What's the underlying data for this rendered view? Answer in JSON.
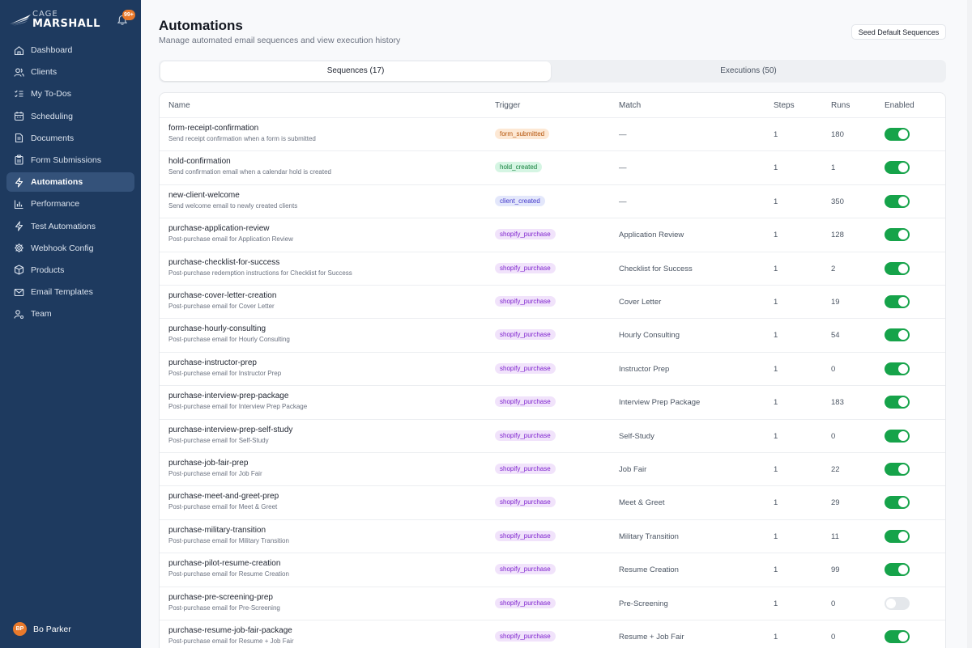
{
  "brand": {
    "top": "CAGE",
    "main": "MARSHALL"
  },
  "notifications": {
    "badge": "99+"
  },
  "sidebar": {
    "items": [
      {
        "label": "Dashboard",
        "icon": "home-icon"
      },
      {
        "label": "Clients",
        "icon": "users-icon"
      },
      {
        "label": "My To-Dos",
        "icon": "list-checks-icon"
      },
      {
        "label": "Scheduling",
        "icon": "calendar-icon"
      },
      {
        "label": "Documents",
        "icon": "file-icon"
      },
      {
        "label": "Form Submissions",
        "icon": "clipboard-icon"
      },
      {
        "label": "Automations",
        "icon": "bolt-icon",
        "active": true
      },
      {
        "label": "Performance",
        "icon": "bar-chart-icon"
      },
      {
        "label": "Test Automations",
        "icon": "bolt-icon"
      },
      {
        "label": "Webhook Config",
        "icon": "gear-icon"
      },
      {
        "label": "Products",
        "icon": "package-icon"
      },
      {
        "label": "Email Templates",
        "icon": "mail-icon"
      },
      {
        "label": "Team",
        "icon": "user-gear-icon"
      }
    ]
  },
  "user": {
    "initials": "BP",
    "name": "Bo Parker"
  },
  "header": {
    "title": "Automations",
    "subtitle": "Manage automated email sequences and view execution history",
    "seed_label": "Seed Default Sequences"
  },
  "tabs": [
    {
      "label": "Sequences (17)",
      "active": true
    },
    {
      "label": "Executions (50)",
      "active": false
    }
  ],
  "table": {
    "columns": [
      "Name",
      "Trigger",
      "Match",
      "Steps",
      "Runs",
      "Enabled"
    ],
    "rows": [
      {
        "name": "form-receipt-confirmation",
        "desc": "Send receipt confirmation when a form is submitted",
        "trigger": "form_submitted",
        "match": "—",
        "steps": "1",
        "runs": "180",
        "enabled": true
      },
      {
        "name": "hold-confirmation",
        "desc": "Send confirmation email when a calendar hold is created",
        "trigger": "hold_created",
        "match": "—",
        "steps": "1",
        "runs": "1",
        "enabled": true
      },
      {
        "name": "new-client-welcome",
        "desc": "Send welcome email to newly created clients",
        "trigger": "client_created",
        "match": "—",
        "steps": "1",
        "runs": "350",
        "enabled": true
      },
      {
        "name": "purchase-application-review",
        "desc": "Post-purchase email for Application Review",
        "trigger": "shopify_purchase",
        "match": "Application Review",
        "steps": "1",
        "runs": "128",
        "enabled": true
      },
      {
        "name": "purchase-checklist-for-success",
        "desc": "Post-purchase redemption instructions for Checklist for Success",
        "trigger": "shopify_purchase",
        "match": "Checklist for Success",
        "steps": "1",
        "runs": "2",
        "enabled": true
      },
      {
        "name": "purchase-cover-letter-creation",
        "desc": "Post-purchase email for Cover Letter",
        "trigger": "shopify_purchase",
        "match": "Cover Letter",
        "steps": "1",
        "runs": "19",
        "enabled": true
      },
      {
        "name": "purchase-hourly-consulting",
        "desc": "Post-purchase email for Hourly Consulting",
        "trigger": "shopify_purchase",
        "match": "Hourly Consulting",
        "steps": "1",
        "runs": "54",
        "enabled": true
      },
      {
        "name": "purchase-instructor-prep",
        "desc": "Post-purchase email for Instructor Prep",
        "trigger": "shopify_purchase",
        "match": "Instructor Prep",
        "steps": "1",
        "runs": "0",
        "enabled": true
      },
      {
        "name": "purchase-interview-prep-package",
        "desc": "Post-purchase email for Interview Prep Package",
        "trigger": "shopify_purchase",
        "match": "Interview Prep Package",
        "steps": "1",
        "runs": "183",
        "enabled": true
      },
      {
        "name": "purchase-interview-prep-self-study",
        "desc": "Post-purchase email for Self-Study",
        "trigger": "shopify_purchase",
        "match": "Self-Study",
        "steps": "1",
        "runs": "0",
        "enabled": true
      },
      {
        "name": "purchase-job-fair-prep",
        "desc": "Post-purchase email for Job Fair",
        "trigger": "shopify_purchase",
        "match": "Job Fair",
        "steps": "1",
        "runs": "22",
        "enabled": true
      },
      {
        "name": "purchase-meet-and-greet-prep",
        "desc": "Post-purchase email for Meet & Greet",
        "trigger": "shopify_purchase",
        "match": "Meet & Greet",
        "steps": "1",
        "runs": "29",
        "enabled": true
      },
      {
        "name": "purchase-military-transition",
        "desc": "Post-purchase email for Military Transition",
        "trigger": "shopify_purchase",
        "match": "Military Transition",
        "steps": "1",
        "runs": "11",
        "enabled": true
      },
      {
        "name": "purchase-pilot-resume-creation",
        "desc": "Post-purchase email for Resume Creation",
        "trigger": "shopify_purchase",
        "match": "Resume Creation",
        "steps": "1",
        "runs": "99",
        "enabled": true
      },
      {
        "name": "purchase-pre-screening-prep",
        "desc": "Post-purchase email for Pre-Screening",
        "trigger": "shopify_purchase",
        "match": "Pre-Screening",
        "steps": "1",
        "runs": "0",
        "enabled": false
      },
      {
        "name": "purchase-resume-job-fair-package",
        "desc": "Post-purchase email for Resume + Job Fair",
        "trigger": "shopify_purchase",
        "match": "Resume + Job Fair",
        "steps": "1",
        "runs": "0",
        "enabled": true
      }
    ]
  },
  "colors": {
    "sidebar_bg": "#1e3a5f",
    "sidebar_active": "#34527a",
    "accent_orange": "#e8792b",
    "toggle_on": "#16a34a",
    "toggle_off": "#e4e7eb",
    "badge_form_submitted": "#fde8d4",
    "badge_hold_created": "#d5f5e3",
    "badge_client_created": "#e3e7fb",
    "badge_shopify_purchase": "#f1e3fb"
  }
}
